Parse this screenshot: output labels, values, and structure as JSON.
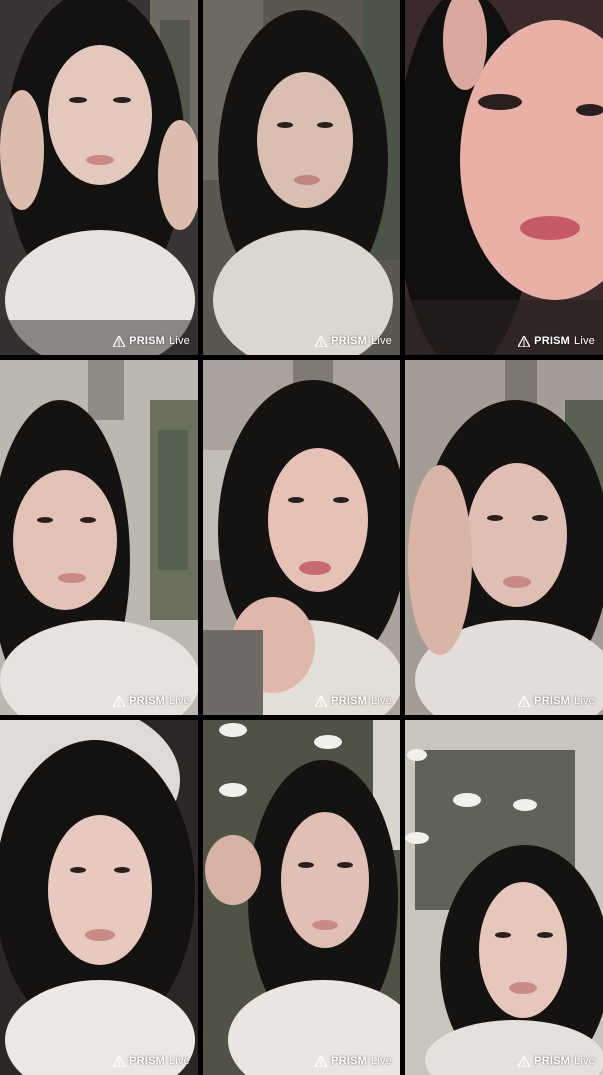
{
  "watermark": {
    "brand": "PRISM",
    "suffix": "Live"
  },
  "tiles": [
    {
      "scene": "bedroom-closet",
      "tone": "#3a3535",
      "face": "#e3c8bd",
      "shirt": "#e8e2de",
      "hair": "#141111"
    },
    {
      "scene": "bedroom-wall",
      "tone": "#5a5650",
      "face": "#d9bfb2",
      "shirt": "#dcd6d0",
      "hair": "#151212"
    },
    {
      "scene": "closeup-warm",
      "tone": "#3b2a2a",
      "face": "#e9b0a8",
      "shirt": "#c9b8b2",
      "hair": "#120f0f"
    },
    {
      "scene": "ceiling-vent",
      "tone": "#bcb7b0",
      "face": "#e2c2b6",
      "shirt": "#e7e2dd",
      "hair": "#151212"
    },
    {
      "scene": "ceiling-light",
      "tone": "#a9a39b",
      "face": "#e6c1b6",
      "shirt": "#e4ded9",
      "hair": "#151212"
    },
    {
      "scene": "ceiling-closet",
      "tone": "#a39d95",
      "face": "#dfbfb4",
      "shirt": "#e2ddd8",
      "hair": "#151212"
    },
    {
      "scene": "pillow-dark",
      "tone": "#2b2727",
      "face": "#e8c9bf",
      "shirt": "#ece7e3",
      "hair": "#141111"
    },
    {
      "scene": "cloud-wall",
      "tone": "#4e5346",
      "face": "#e0c0b5",
      "shirt": "#e9e5e1",
      "hair": "#151212"
    },
    {
      "scene": "cloud-window",
      "tone": "#5f6357",
      "face": "#e6c7bb",
      "shirt": "#e5e0dc",
      "hair": "#151212"
    }
  ]
}
